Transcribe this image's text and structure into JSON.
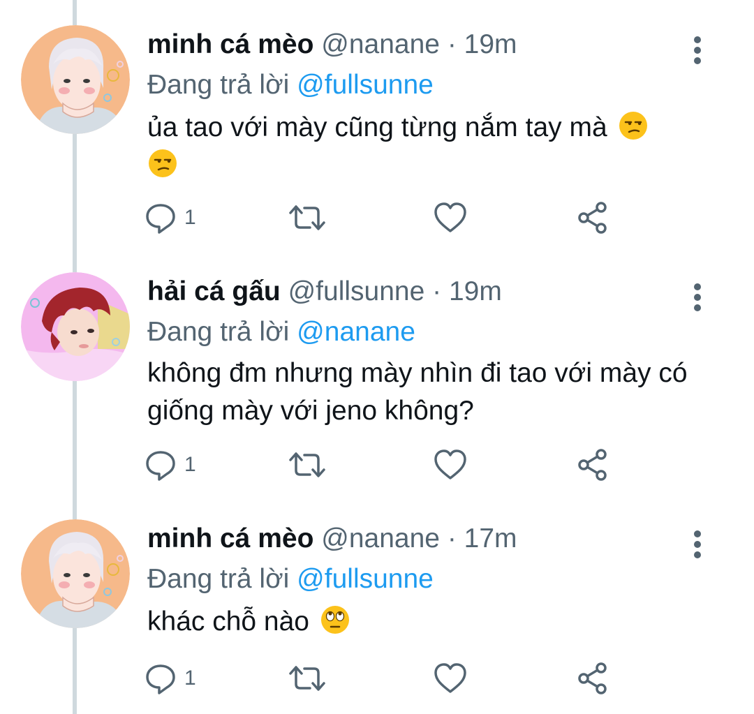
{
  "tweets": [
    {
      "name": "minh cá mèo",
      "handle": "@nanane",
      "dot": "·",
      "time": "19m",
      "replying_prefix": "Đang trả lời",
      "replying_to": "@fullsunne",
      "text": "ủa tao với mày cũng từng nắm tay mà",
      "emojis": [
        "unamused-face",
        "unamused-face"
      ],
      "reply_count": "1"
    },
    {
      "name": "hải cá gấu",
      "handle": "@fullsunne",
      "dot": "·",
      "time": "19m",
      "replying_prefix": "Đang trả lời",
      "replying_to": "@nanane",
      "text": "không đm nhưng mày nhìn đi tao với mày có giống mày với jeno không?",
      "emojis": [],
      "reply_count": "1"
    },
    {
      "name": "minh cá mèo",
      "handle": "@nanane",
      "dot": "·",
      "time": "17m",
      "replying_prefix": "Đang trả lời",
      "replying_to": "@fullsunne",
      "text": "khác chỗ nào",
      "emojis": [
        "rolling-eyes-face"
      ],
      "reply_count": "1"
    }
  ],
  "icons": {
    "reply": "reply-icon",
    "retweet": "retweet-icon",
    "like": "heart-icon",
    "share": "share-icon",
    "more": "more-vertical-icon"
  },
  "colors": {
    "name": "#0f1419",
    "secondary": "#536471",
    "mention": "#1d9bf0",
    "thread_line": "#cfd9de"
  }
}
